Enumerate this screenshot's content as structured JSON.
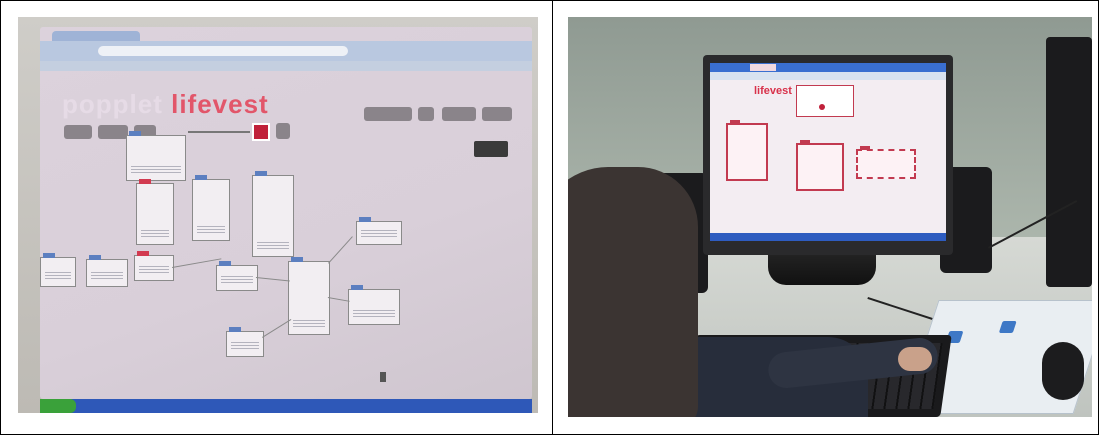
{
  "left_photo": {
    "subject": "monitor-showing-popplet-mind-map",
    "logo_first_word": "popplet",
    "logo_second_word": "lifevest",
    "colors": {
      "accent": "#e2566a",
      "note_tab_blue": "#5c7fc0",
      "note_tab_red": "#d23a50",
      "taskbar": "#2e58b8"
    }
  },
  "right_photo": {
    "subject": "child-using-desktop-computer",
    "logo_word": "lifevest",
    "colors": {
      "accent": "#d8314a",
      "monitor": "#2a2a2c",
      "wall": "#9aa39b"
    }
  }
}
